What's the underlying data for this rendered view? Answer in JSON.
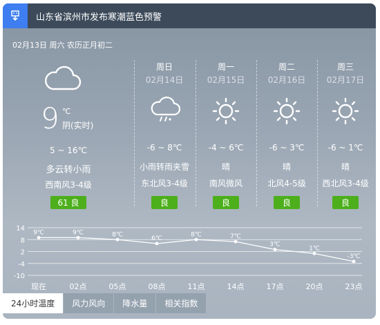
{
  "alert": {
    "icon": "cold-wave-warning-icon",
    "text": "山东省滨州市发布寒潮蓝色预警",
    "color": "#3e7ef0"
  },
  "date_line": "02月13日 周六 农历正月初二",
  "today": {
    "icon": "cloudy-icon",
    "temp": "9",
    "unit": "℃",
    "desc": "阴(实时)",
    "range": "5 ~ 16℃",
    "weather": "多云转小雨",
    "wind": "西南风3-4级",
    "aqi": "61 良"
  },
  "days": [
    {
      "name": "周日",
      "date": "02月14日",
      "icon": "rain-sleet-icon",
      "range": "-6 ~ 8℃",
      "weather": "小雨转雨夹雪",
      "wind": "东北风3-4级",
      "aqi": "良"
    },
    {
      "name": "周一",
      "date": "02月15日",
      "icon": "sunny-icon",
      "range": "-4 ~ 6℃",
      "weather": "晴",
      "wind": "南风微风",
      "aqi": "良"
    },
    {
      "name": "周二",
      "date": "02月16日",
      "icon": "sunny-icon",
      "range": "-6 ~ 3℃",
      "weather": "晴",
      "wind": "北风4-5级",
      "aqi": "良"
    },
    {
      "name": "周三",
      "date": "02月17日",
      "icon": "sunny-icon",
      "range": "-6 ~ 1℃",
      "weather": "晴",
      "wind": "西北风3-4级",
      "aqi": "良"
    }
  ],
  "chart_data": {
    "type": "line",
    "categories": [
      "现在",
      "02点",
      "05点",
      "08点",
      "11点",
      "14点",
      "17点",
      "20点",
      "23点"
    ],
    "values": [
      9,
      9,
      8,
      6,
      8,
      7,
      3,
      1,
      -3
    ],
    "labels": [
      "9℃",
      "9℃",
      "8℃",
      "6℃",
      "8℃",
      "7℃",
      "3℃",
      "1℃",
      "-3℃"
    ],
    "yticks": [
      "14",
      "8",
      "2",
      "-4",
      "-10"
    ],
    "ylim": [
      -10,
      14
    ],
    "grid": true
  },
  "tabs": [
    "24小时温度",
    "风力风向",
    "降水量",
    "相关指数"
  ],
  "colors": {
    "aqi_good": "#4caf1b",
    "alert_bar": "#3c4a5a"
  }
}
